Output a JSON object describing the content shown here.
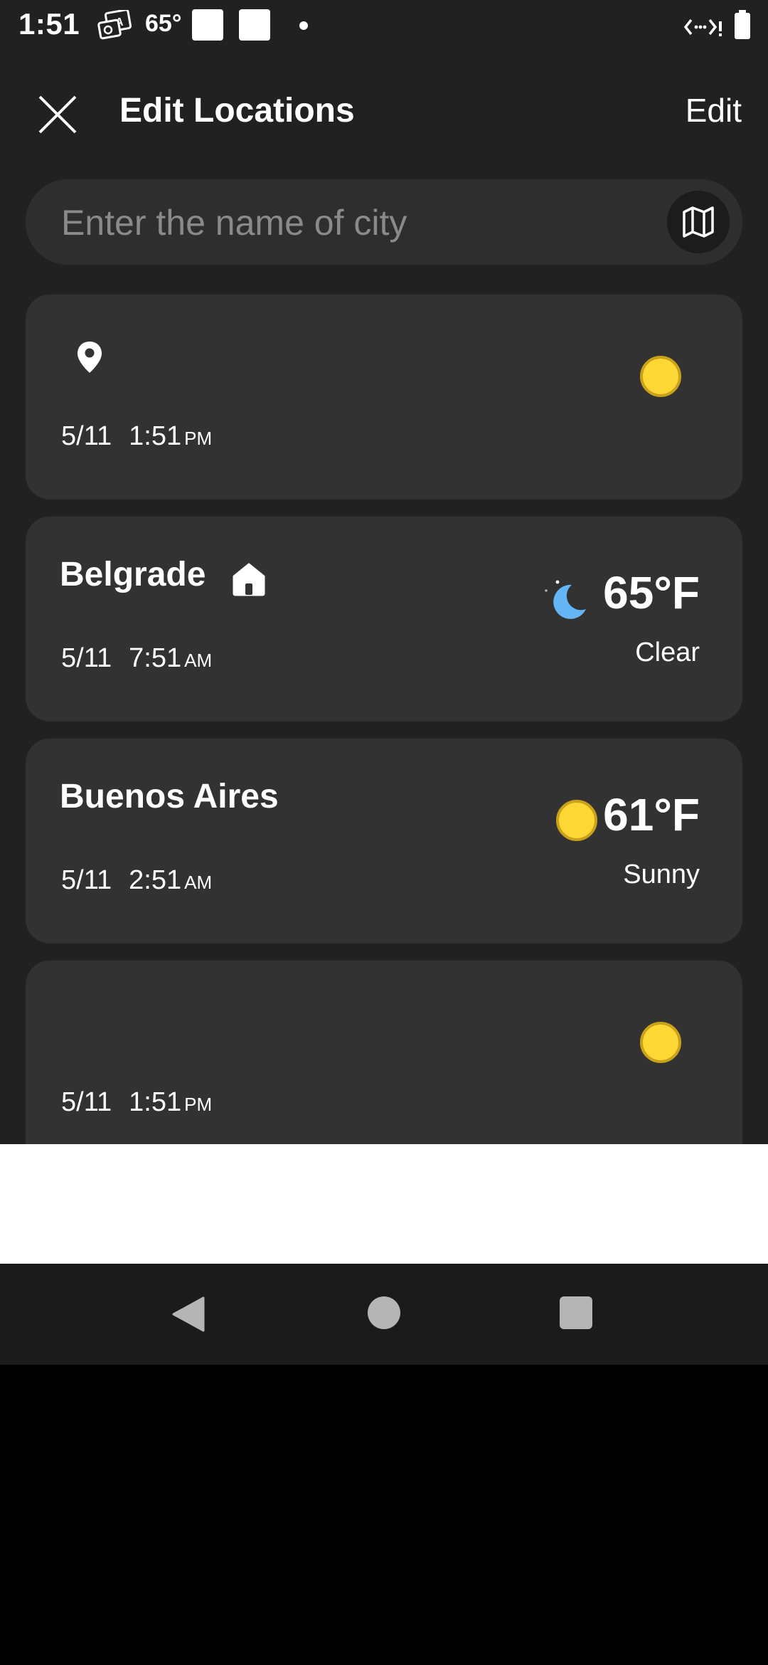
{
  "status_bar": {
    "time": "1:51",
    "temperature": "65°"
  },
  "header": {
    "title": "Edit Locations",
    "edit_label": "Edit"
  },
  "search": {
    "placeholder": "Enter the name of city"
  },
  "locations": [
    {
      "city": "",
      "date": "5/11",
      "time": "1:51",
      "ampm": "PM",
      "icon": "sun-icon",
      "temp": "",
      "condition": ""
    },
    {
      "city": "Belgrade",
      "date": "5/11",
      "time": "7:51",
      "ampm": "AM",
      "icon": "moon-icon",
      "temp": "65°F",
      "condition": "Clear"
    },
    {
      "city": "Buenos Aires",
      "date": "5/11",
      "time": "2:51",
      "ampm": "AM",
      "icon": "sun-icon",
      "temp": "61°F",
      "condition": "Sunny"
    },
    {
      "city": "",
      "date": "5/11",
      "time": "1:51",
      "ampm": "PM",
      "icon": "sun-icon",
      "temp": "",
      "condition": ""
    }
  ],
  "colors": {
    "background": "#212121",
    "card": "#323232",
    "sun": "#fdd835",
    "moon": "#64b5f6"
  }
}
